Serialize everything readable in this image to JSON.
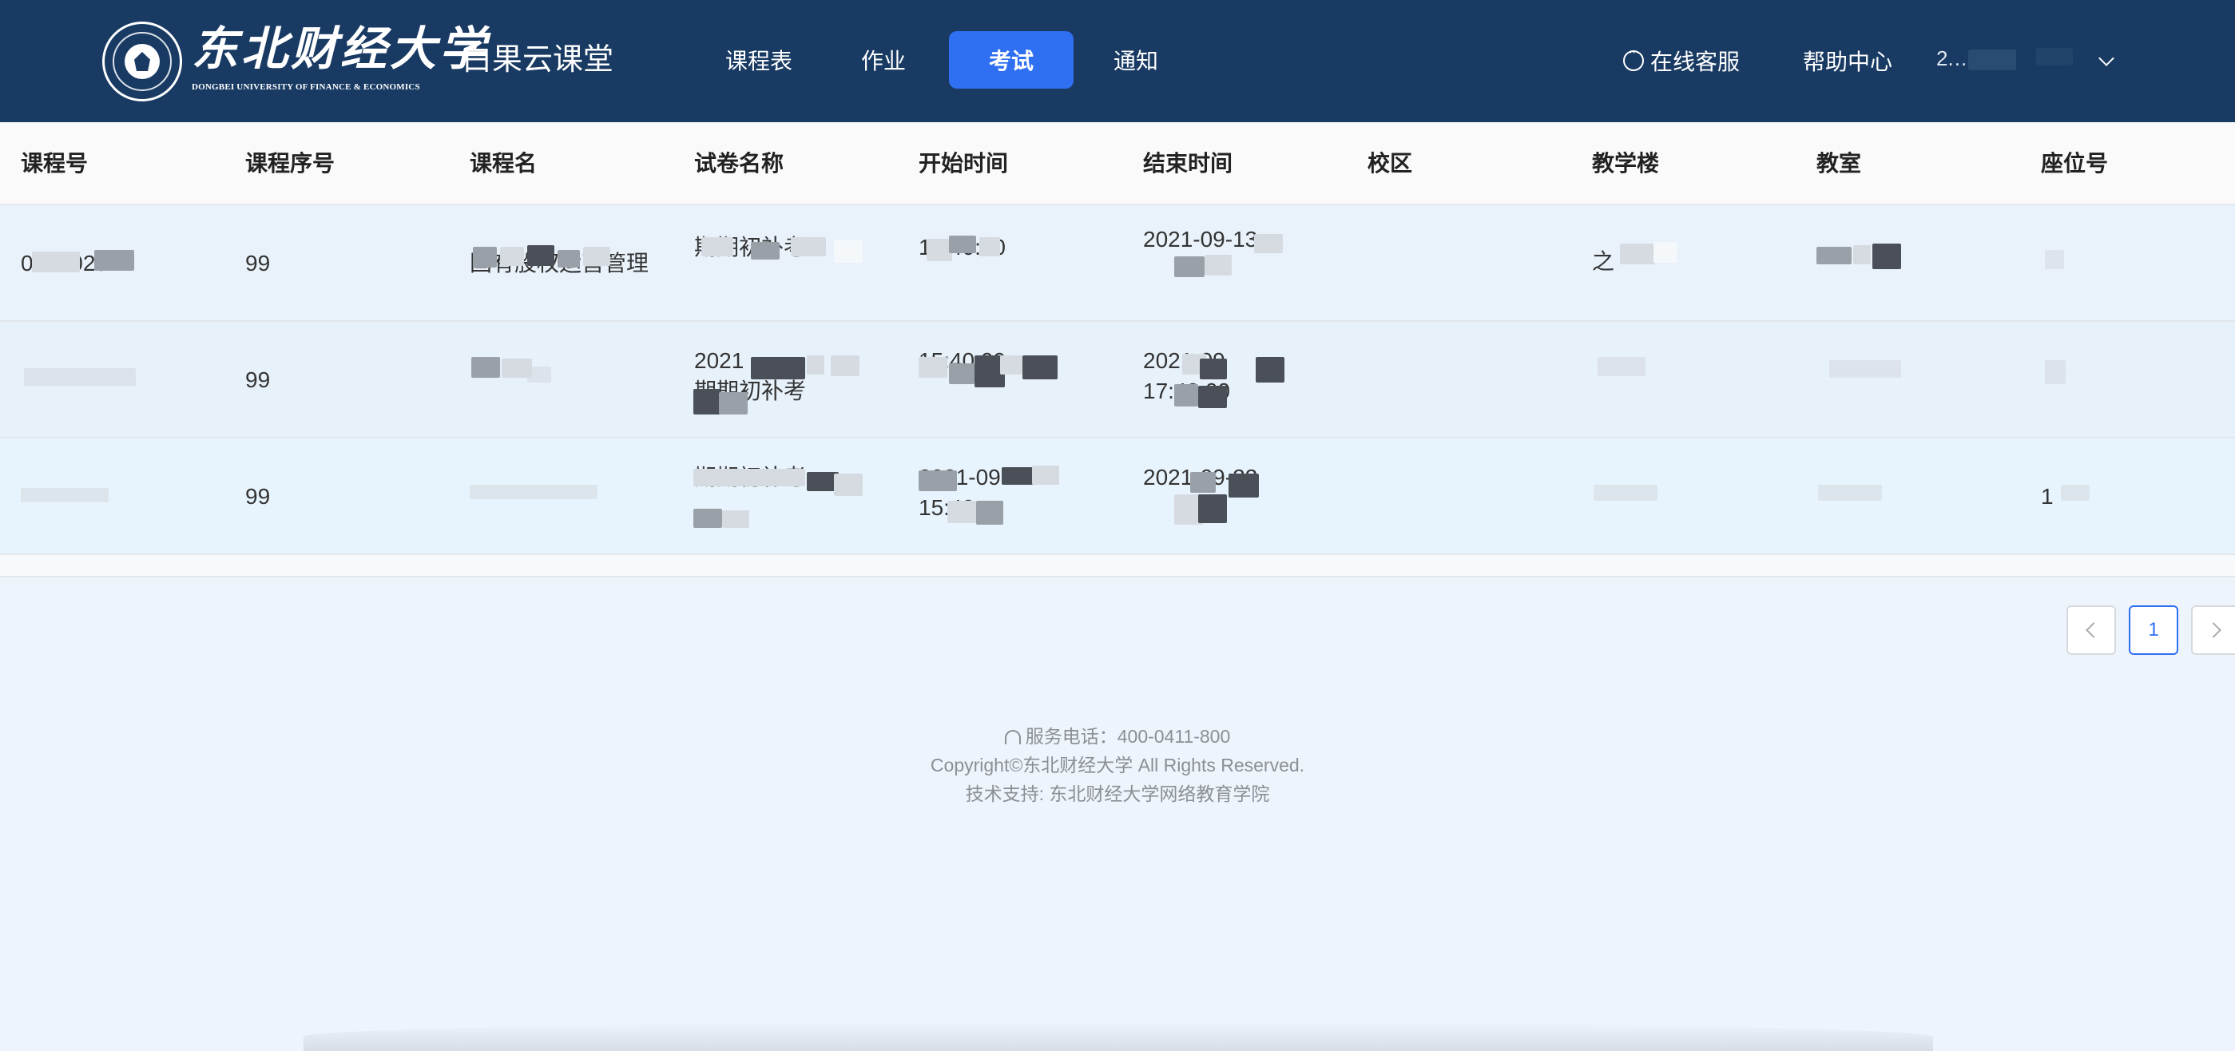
{
  "header": {
    "logo_cn": "东北财经大学",
    "logo_en": "DONGBEI UNIVERSITY OF FINANCE & ECONOMICS",
    "app_title": "白果云课堂",
    "nav": [
      {
        "label": "课程表",
        "active": false
      },
      {
        "label": "作业",
        "active": false
      },
      {
        "label": "考试",
        "active": true
      },
      {
        "label": "通知",
        "active": false
      }
    ],
    "service_label": "在线客服",
    "help_label": "帮助中心",
    "user_name": "2.…"
  },
  "table": {
    "columns": [
      "课程号",
      "课程序号",
      "课程名",
      "试卷名称",
      "开始时间",
      "结束时间",
      "校区",
      "教学楼",
      "教室",
      "座位号"
    ],
    "rows": [
      {
        "course_no": "01040252",
        "seq": "99",
        "course_name": "国有股权运营管理",
        "paper_line1": "",
        "paper_line2": "期期初补考",
        "start_line1": "",
        "start_line2": "15:40:00",
        "end_line1": "2021-09-13",
        "end_line2": "",
        "campus": "",
        "building": "之",
        "room": "",
        "seat": ""
      },
      {
        "course_no": "",
        "seq": "99",
        "course_name": "",
        "paper_line1": "2021",
        "paper_line2": "期期初补考",
        "start_line1": "",
        "start_line2": "15:40:00",
        "end_line1": "2021-09",
        "end_line2": "17:40:00",
        "campus": "",
        "building": "",
        "room": "",
        "seat": ""
      },
      {
        "course_no": "",
        "seq": "99",
        "course_name": "",
        "paper_line1": "",
        "paper_line2": "期期初补考",
        "start_line1": "2021-09-22",
        "start_line2": "15:40",
        "end_line1": "2021-09-22",
        "end_line2": "",
        "campus": "",
        "building": "",
        "room": "",
        "seat": "1"
      }
    ]
  },
  "pagination": {
    "current_page": "1"
  },
  "footer": {
    "phone": "服务电话：400-0411-800",
    "copyright": "Copyright©东北财经大学 All Rights Reserved.",
    "support": "技术支持: 东北财经大学网络教育学院"
  },
  "colors": {
    "header_bg": "#183a63",
    "nav_active": "#2f6ff2",
    "page_bg": "#eef4fb"
  }
}
